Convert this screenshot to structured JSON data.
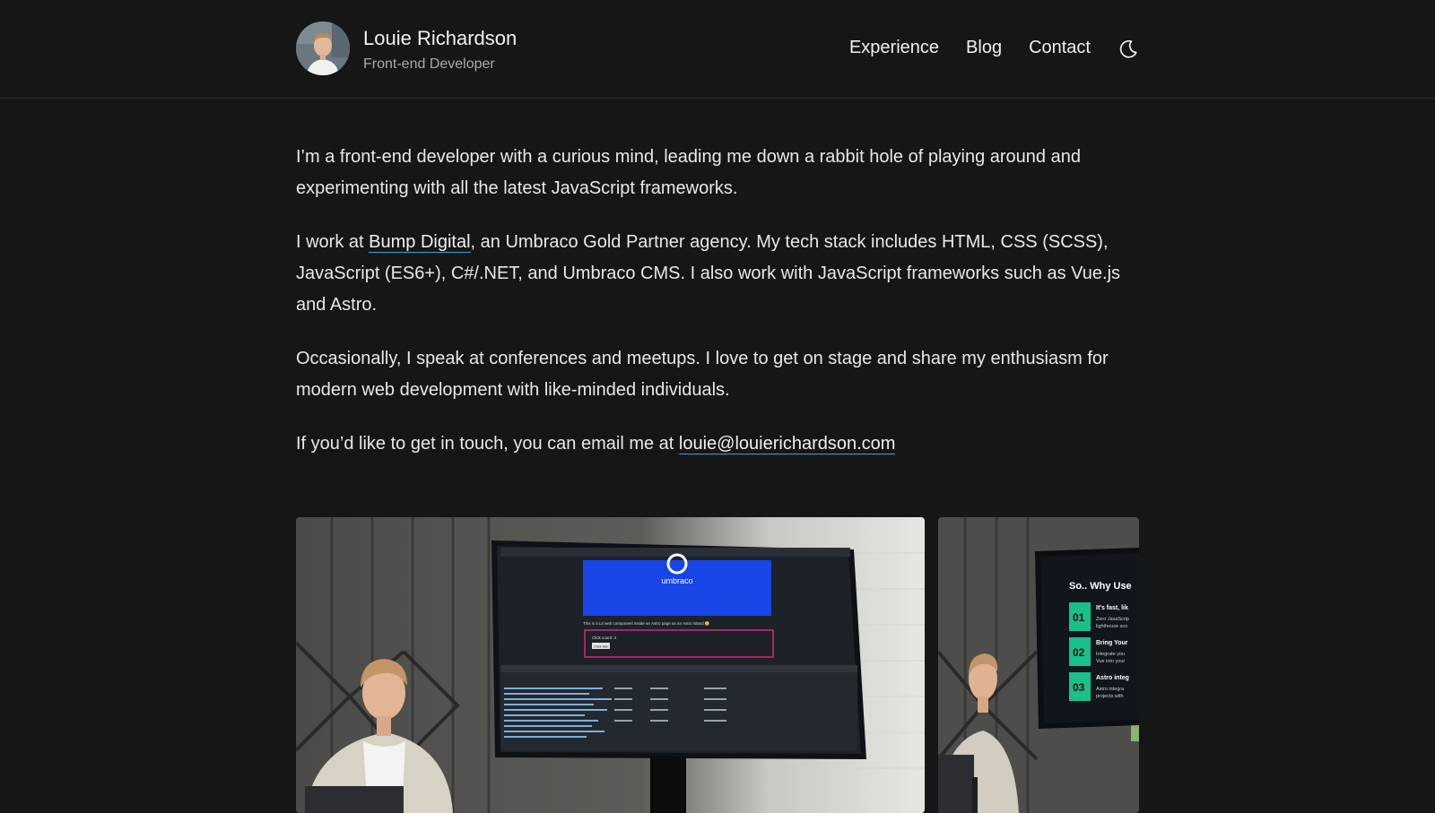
{
  "header": {
    "name": "Louie Richardson",
    "role": "Front-end Developer",
    "avatar_icon": "avatar-photo",
    "nav": [
      {
        "label": "Experience"
      },
      {
        "label": "Blog"
      },
      {
        "label": "Contact"
      }
    ],
    "theme_toggle_icon": "moon-icon"
  },
  "about": {
    "p1": "I’m a front-end developer with a curious mind, leading me down a rabbit hole of playing around and experimenting with all the latest JavaScript frameworks.",
    "p2_before": "I work at ",
    "p2_link": "Bump Digital",
    "p2_after": ", an Umbraco Gold Partner agency. My tech stack includes HTML, CSS (SCSS), JavaScript (ES6+), C#/.NET, and Umbraco CMS. I also work with JavaScript frameworks such as Vue.js and Astro.",
    "p3": "Occasionally, I speak at conferences and meetups. I love to get on stage and share my enthusiasm for modern web development with like-minded individuals.",
    "p4_before": "If you’d like to get in touch, you can email me at ",
    "p4_link": "louie@louierichardson.com"
  },
  "gallery": {
    "photo1": {
      "screen_logo": "umbraco",
      "screen_line": "This is a Lit web component inside an Astro page as an Astro island 😊",
      "click_count": "Click count: 4",
      "button_label": "Click Me!"
    },
    "photo2": {
      "slide_title": "So.. Why Use",
      "items": [
        {
          "num": "01",
          "title": "It's fast, lik",
          "sub1": "Zero JavaScrip",
          "sub2": "lighthouse sco"
        },
        {
          "num": "02",
          "title": "Bring Your",
          "sub1": "Integrate you",
          "sub2": "Vue into your"
        },
        {
          "num": "03",
          "title": "Astro integ",
          "sub1": "Astro integra",
          "sub2": "projects with"
        }
      ]
    }
  },
  "colors": {
    "background": "#161616",
    "link_underline": "#3ea0d8",
    "slide_accent": "#19c08a",
    "umbraco_blue": "#1745e6"
  }
}
